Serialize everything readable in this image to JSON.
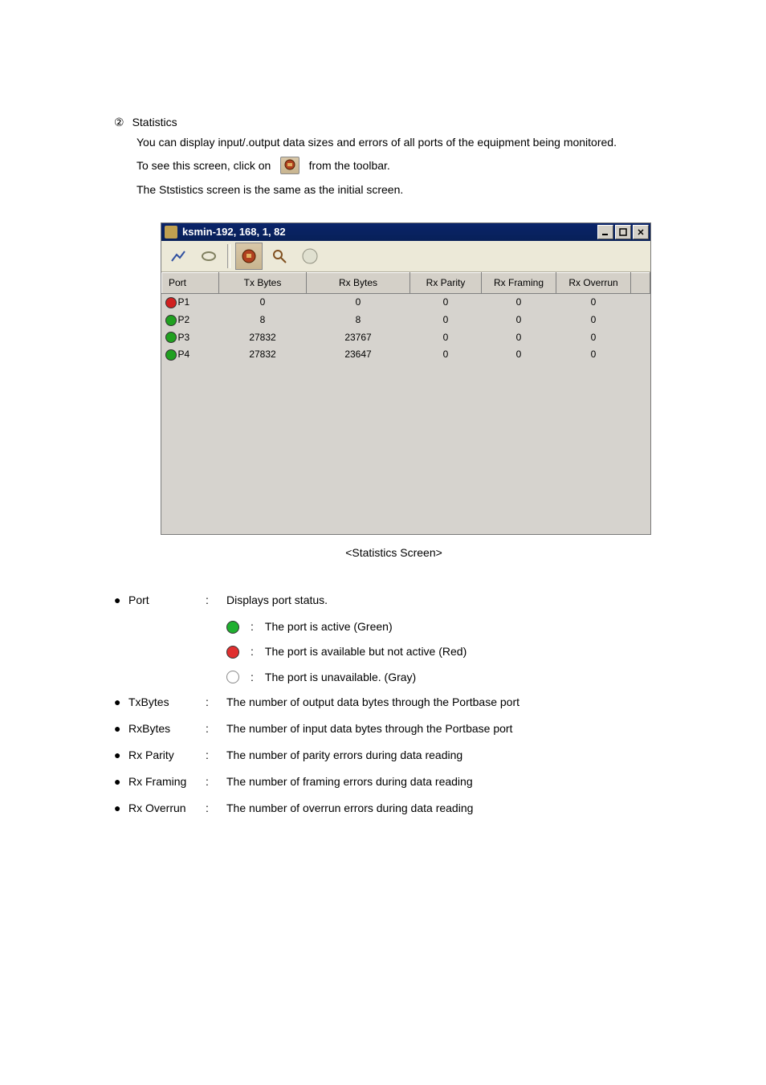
{
  "section": {
    "number": "②",
    "title": "Statistics",
    "line1": "You can display input/.output data sizes and errors of all ports of the equipment being monitored.",
    "line2a": "To  see  this  screen,  click  on",
    "line2b": "from the toolbar.",
    "line3": "The Ststistics screen is the same as the initial screen."
  },
  "window": {
    "title": "ksmin-192, 168, 1, 82",
    "columns": [
      "Port",
      "Tx Bytes",
      "Rx Bytes",
      "Rx Parity",
      "Rx Framing",
      "Rx Overrun"
    ],
    "rows": [
      {
        "port": "P1",
        "color": "#d02020",
        "tx": "0",
        "rx": "0",
        "parity": "0",
        "framing": "0",
        "overrun": "0"
      },
      {
        "port": "P2",
        "color": "#20a020",
        "tx": "8",
        "rx": "8",
        "parity": "0",
        "framing": "0",
        "overrun": "0"
      },
      {
        "port": "P3",
        "color": "#20a020",
        "tx": "27832",
        "rx": "23767",
        "parity": "0",
        "framing": "0",
        "overrun": "0"
      },
      {
        "port": "P4",
        "color": "#20a020",
        "tx": "27832",
        "rx": "23647",
        "parity": "0",
        "framing": "0",
        "overrun": "0"
      }
    ]
  },
  "caption": "<Statistics Screen>",
  "defs": [
    {
      "term": "Port",
      "desc": "Displays port status."
    },
    {
      "term": "TxBytes",
      "desc": "The number of output data bytes through the Portbase port"
    },
    {
      "term": "RxBytes",
      "desc": "The number of input data bytes through the Portbase port"
    },
    {
      "term": "Rx Parity",
      "desc": "The number of parity errors during data reading"
    },
    {
      "term": "Rx Framing",
      "desc": "The number of framing errors during data reading"
    },
    {
      "term": "Rx Overrun",
      "desc": "The number of overrun errors during data reading"
    }
  ],
  "legend": [
    {
      "color": "#20b030",
      "text": "The port is active (Green)"
    },
    {
      "color": "#e03030",
      "text": "The port is available but not active (Red)"
    },
    {
      "color": "#ffffff",
      "stroke": "#888",
      "text": "The port is unavailable. (Gray)"
    }
  ]
}
